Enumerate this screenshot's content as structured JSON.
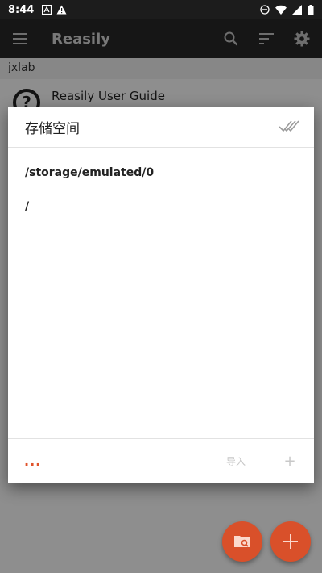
{
  "status_bar": {
    "time": "8:44"
  },
  "app_bar": {
    "title": "Reasily"
  },
  "breadcrumb": {
    "label": "jxlab"
  },
  "list": {
    "items": [
      {
        "label": "Reasily User Guide"
      }
    ]
  },
  "dialog": {
    "title": "存储空间",
    "paths": [
      "/storage/emulated/0",
      "/"
    ],
    "footer": {
      "more_label": "...",
      "import_label": "导入",
      "add_label": "+"
    }
  },
  "colors": {
    "accent": "#d9502a",
    "app_bar": "#262626",
    "status_bar": "#1c1c1c"
  }
}
